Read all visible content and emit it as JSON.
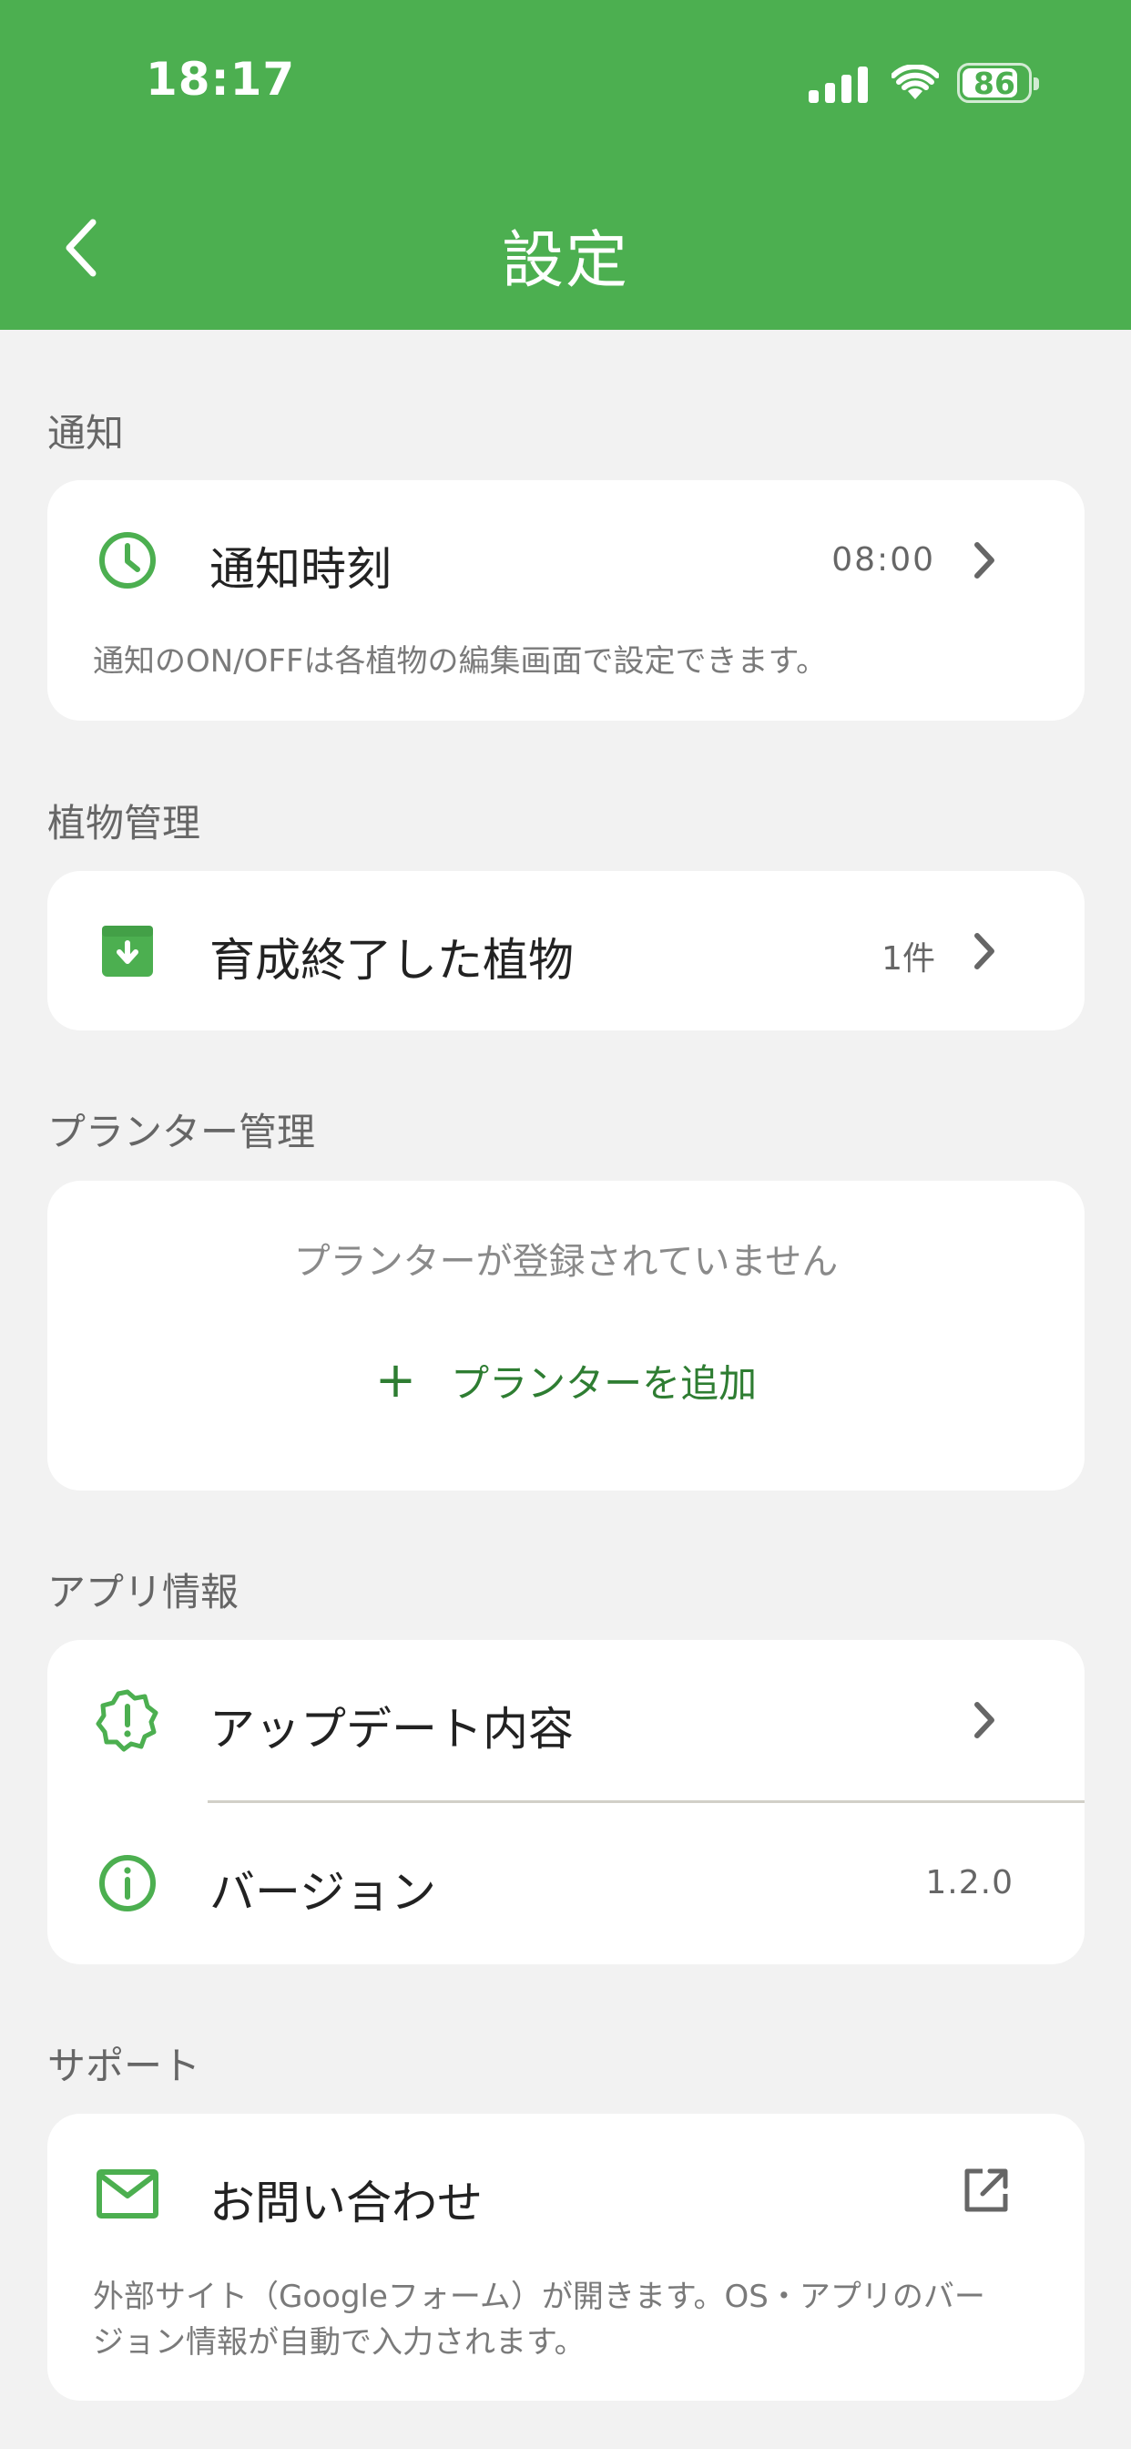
{
  "status_bar": {
    "time": "18:17",
    "battery": "86",
    "battery_level": 0.86
  },
  "header": {
    "title": "設定"
  },
  "sections": {
    "notification": {
      "label": "通知",
      "row_label": "通知時刻",
      "row_value": "08:00",
      "note": "通知のON/OFFは各植物の編集画面で設定できます。"
    },
    "plants": {
      "label": "植物管理",
      "row_label": "育成終了した植物",
      "row_value": "1件"
    },
    "planters": {
      "label": "プランター管理",
      "empty_text": "プランターが登録されていません",
      "add_plus": "+",
      "add_label": "プランターを追加"
    },
    "app_info": {
      "label": "アプリ情報",
      "updates_label": "アップデート内容",
      "version_label": "バージョン",
      "version_value": "1.2.0"
    },
    "support": {
      "label": "サポート",
      "contact_label": "お問い合わせ",
      "note_line1": "外部サイト（Googleフォーム）が開きます。OS・アプリのバー",
      "note_line2": "ジョン情報が自動で入力されます。"
    }
  },
  "colors": {
    "accent": "#4caf50",
    "accent_dark": "#2e7d32",
    "background": "#f2f2f2"
  },
  "icons": [
    "back-chevron-icon",
    "clock-icon",
    "archive-icon",
    "badge-alert-icon",
    "info-icon",
    "mail-icon",
    "external-link-icon",
    "chevron-right-icon"
  ]
}
